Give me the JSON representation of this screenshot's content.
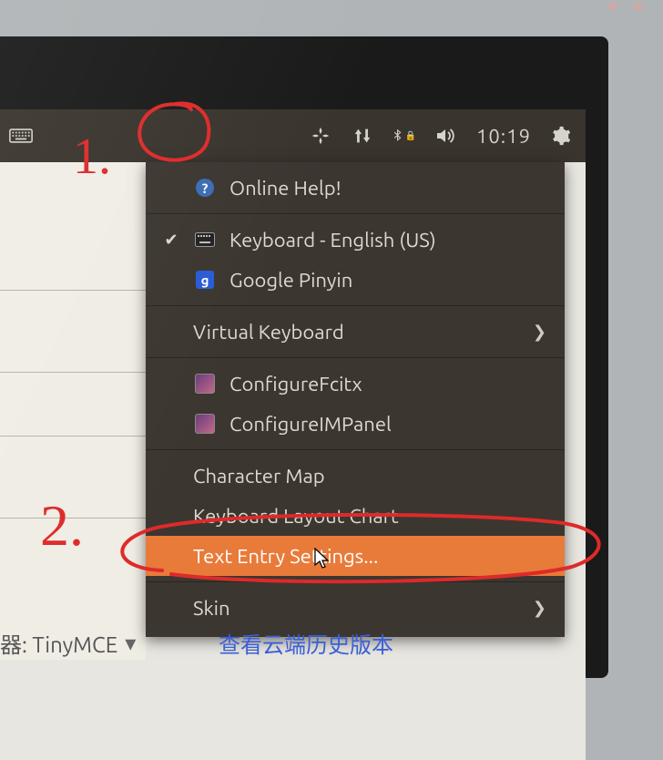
{
  "top_bar": {
    "clock": "10:19"
  },
  "menu": {
    "online_help": "Online Help!",
    "keyboard_english": "Keyboard - English (US)",
    "google_pinyin": "Google Pinyin",
    "virtual_keyboard": "Virtual Keyboard",
    "configure_fcitx": "ConfigureFcitx",
    "configure_impanel": "ConfigureIMPanel",
    "character_map": "Character Map",
    "keyboard_layout_chart": "Keyboard Layout Chart",
    "text_entry_settings": "Text Entry Settings...",
    "skin": "Skin"
  },
  "background": {
    "editor_label_fragment": "器: TinyMCE",
    "cloud_history": "查看云端历史版本"
  },
  "annotations": {
    "one": "1.",
    "two": "2."
  }
}
